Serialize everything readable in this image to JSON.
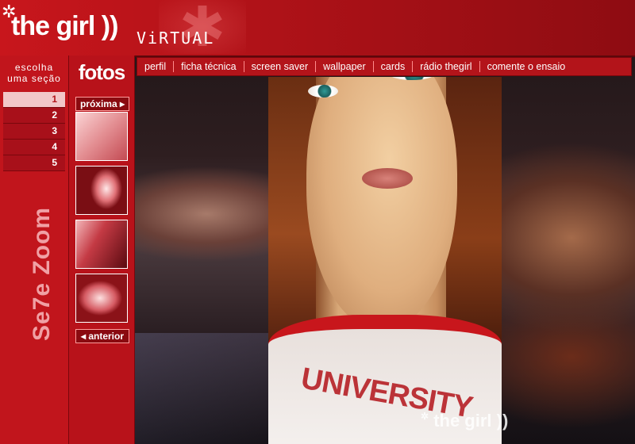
{
  "header": {
    "logo_text": "the girl",
    "logo_paren": "))",
    "subtitle": "ViRTUAL"
  },
  "topnav": {
    "items": [
      "perfil",
      "ficha técnica",
      "screen saver",
      "wallpaper",
      "cards",
      "rádio thegirl",
      "comente o ensaio"
    ]
  },
  "sidebar": {
    "escolha_line1": "escolha",
    "escolha_line2": "uma seção",
    "numbers": [
      "1",
      "2",
      "3",
      "4",
      "5"
    ],
    "active": "1",
    "brand": "Se7e Zoom"
  },
  "fotos": {
    "title": "fotos",
    "next": "próxima ▸",
    "prev": "◂ anterior"
  },
  "portrait": {
    "shirt_text": "UNIVERSITY"
  },
  "watermark": {
    "text": "the girl",
    "paren": "))"
  },
  "icons": {
    "header_star": "asterisk-flower-icon"
  },
  "colors": {
    "brand_red": "#c8161c",
    "dark_red": "#7a070c",
    "active_pink": "#f2c7c8"
  }
}
